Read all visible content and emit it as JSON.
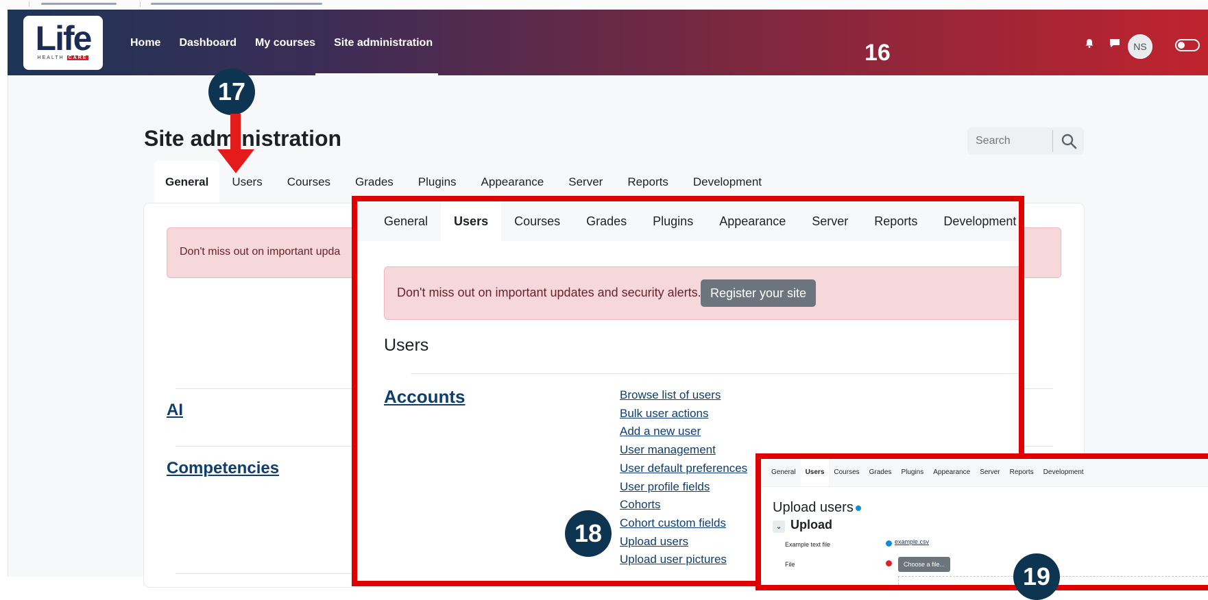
{
  "navbar": {
    "logo_word": "Life",
    "logo_tag_a": "HEALTH",
    "logo_tag_b": "CARE",
    "links": [
      "Home",
      "Dashboard",
      "My courses",
      "Site administration"
    ],
    "step_number": "16",
    "avatar_initials": "NS",
    "colors": {
      "gradient_start": "#1d3557",
      "gradient_end": "#c0232e"
    }
  },
  "page": {
    "title": "Site administration",
    "search_placeholder": "Search",
    "tabs": [
      "General",
      "Users",
      "Courses",
      "Grades",
      "Plugins",
      "Appearance",
      "Server",
      "Reports",
      "Development"
    ],
    "active_tab": "General",
    "alert_text": "Don't miss out on important upda",
    "sections": [
      "AI",
      "Competencies"
    ]
  },
  "callouts": {
    "badge_17": "17",
    "badge_18": "18",
    "badge_19": "19",
    "accent_color": "#e31b1b",
    "badge_color": "#0d3552"
  },
  "overlay_users": {
    "tabs": [
      "General",
      "Users",
      "Courses",
      "Grades",
      "Plugins",
      "Appearance",
      "Server",
      "Reports",
      "Development"
    ],
    "active_tab": "Users",
    "alert_text": "Don't miss out on important updates and security alerts.",
    "register_button": "Register your site",
    "heading": "Users",
    "accounts_label": "Accounts",
    "account_links": [
      "Browse list of users",
      "Bulk user actions",
      "Add a new user",
      "User management",
      "User default preferences",
      "User profile fields",
      "Cohorts",
      "Cohort custom fields",
      "Upload users",
      "Upload user pictures"
    ]
  },
  "overlay_upload": {
    "tabs": [
      "General",
      "Users",
      "Courses",
      "Grades",
      "Plugins",
      "Appearance",
      "Server",
      "Reports",
      "Development"
    ],
    "active_tab": "Users",
    "title": "Upload users",
    "section": "Upload",
    "example_label": "Example text file",
    "example_link": "example.csv",
    "file_label": "File",
    "choose_button": "Choose a file..."
  }
}
